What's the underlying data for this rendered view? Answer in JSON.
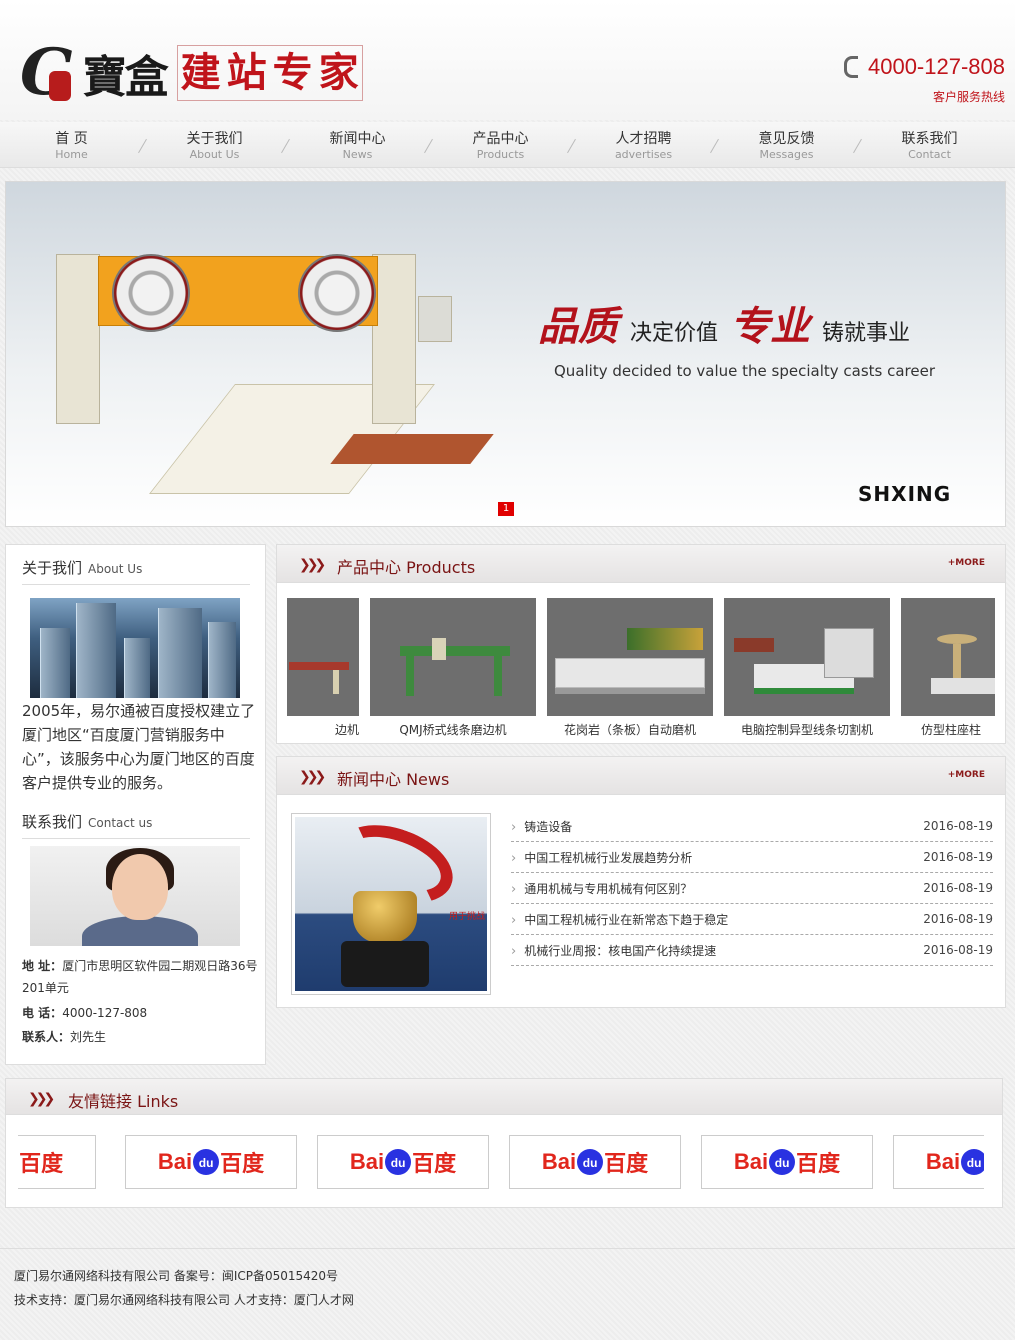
{
  "header": {
    "logo_brand": "寶盒",
    "logo_slogan": [
      "建",
      "站",
      "专",
      "家"
    ],
    "hotline_number": "4000-127-808",
    "hotline_label": "客户服务热线"
  },
  "nav": [
    {
      "cn": "首 页",
      "en": "Home"
    },
    {
      "cn": "关于我们",
      "en": "About Us"
    },
    {
      "cn": "新闻中心",
      "en": "News"
    },
    {
      "cn": "产品中心",
      "en": "Products"
    },
    {
      "cn": "人才招聘",
      "en": "advertises"
    },
    {
      "cn": "意见反馈",
      "en": "Messages"
    },
    {
      "cn": "联系我们",
      "en": "Contact"
    }
  ],
  "banner": {
    "headline_1": "品质",
    "headline_2": "决定价值",
    "headline_3": "专业",
    "headline_4": "铸就事业",
    "subtitle": "Quality decided to value the specialty casts career",
    "brand": "SHXING",
    "slide_indicator": "1"
  },
  "about": {
    "title": "关于我们",
    "title_en": "About Us",
    "text": "2005年，易尔通被百度授权建立了厦门地区“百度厦门营销服务中心”，该服务中心为厦门地区的百度客户提供专业的服务。"
  },
  "contact": {
    "title": "联系我们",
    "title_en": "Contact us",
    "address_label": "地 址：",
    "address": "厦门市思明区软件园二期观日路36号201单元",
    "phone_label": "电 话：",
    "phone": "4000-127-808",
    "person_label": "联系人：",
    "person": "刘先生"
  },
  "products": {
    "title": "产品中心 Products",
    "more": "+MORE",
    "items": [
      {
        "name": "边机"
      },
      {
        "name": "QMJ桥式线条磨边机"
      },
      {
        "name": "花岗岩（条板）自动磨机"
      },
      {
        "name": "电脑控制异型线条切割机"
      },
      {
        "name": "仿型柱座柱"
      }
    ]
  },
  "news": {
    "title": "新闻中心 News",
    "more": "+MORE",
    "photo_caption": "用于挑战",
    "items": [
      {
        "title": "铸造设备",
        "date": "2016-08-19"
      },
      {
        "title": "中国工程机械行业发展趋势分析",
        "date": "2016-08-19"
      },
      {
        "title": "通用机械与专用机械有何区别？",
        "date": "2016-08-19"
      },
      {
        "title": "中国工程机械行业在新常态下趋于稳定",
        "date": "2016-08-19"
      },
      {
        "title": "机械行业周报：核电国产化持续提速",
        "date": "2016-08-19"
      }
    ]
  },
  "links": {
    "title": "友情链接 Links",
    "logo_text_1": "Bai",
    "logo_text_2": "du",
    "logo_text_3": "百度"
  },
  "footer": {
    "line1": "厦门易尔通网络科技有限公司 备案号：闽ICP备05015420号",
    "line2": "技术支持：厦门易尔通网络科技有限公司 人才支持：厦门人才网"
  },
  "colors": {
    "accent_red": "#c0141b",
    "title_red": "#7a1414",
    "baidu_blue": "#2932e1"
  }
}
